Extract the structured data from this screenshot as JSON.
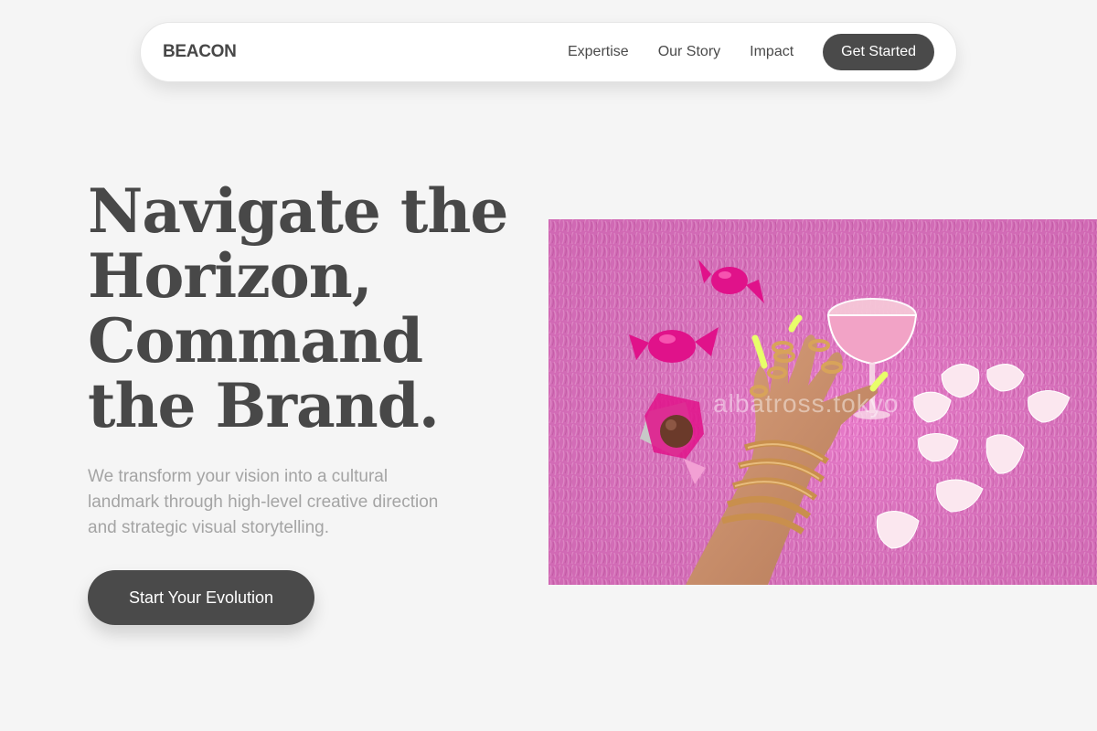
{
  "nav": {
    "brand": "BEACON",
    "links": [
      "Expertise",
      "Our Story",
      "Impact"
    ],
    "cta": "Get Started"
  },
  "hero": {
    "title_lines": [
      "Navigate the",
      "Horizon,",
      "Command",
      "the Brand."
    ],
    "subtitle": "We transform your vision into a cultural landmark through high-level creative direction and strategic visual storytelling.",
    "cta": "Start Your Evolution",
    "image": {
      "description_icon": "photo-hand-with-gold-jewelry",
      "watermark": "albatross.tokyo"
    }
  },
  "colors": {
    "background": "#f5f5f5",
    "primary": "#4a4a4a",
    "subtitle": "#a4a4a4",
    "image_pink": "#e979c8",
    "candy_magenta": "#e0128a"
  }
}
